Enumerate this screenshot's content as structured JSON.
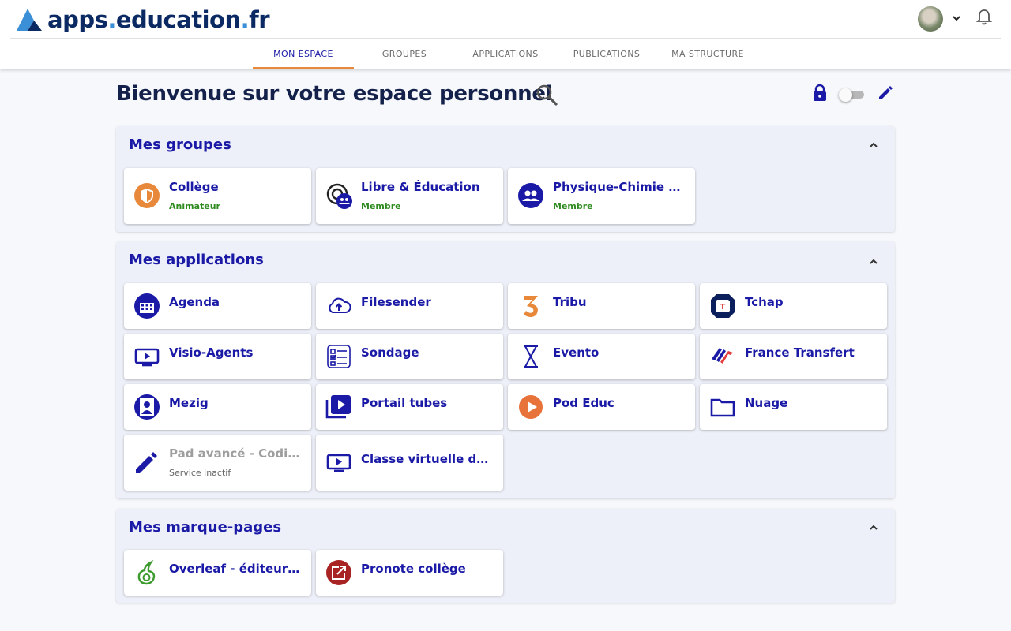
{
  "header": {
    "logo_prefix": "apps",
    "logo_dot1": ".",
    "logo_middle": "education",
    "logo_dot2": ".",
    "logo_suffix": "fr",
    "tabs": [
      {
        "label": "MON ESPACE",
        "active": true
      },
      {
        "label": "GROUPES",
        "active": false
      },
      {
        "label": "APPLICATIONS",
        "active": false
      },
      {
        "label": "PUBLICATIONS",
        "active": false
      },
      {
        "label": "MA STRUCTURE",
        "active": false
      }
    ]
  },
  "page": {
    "title": "Bienvenue sur votre espace personnel"
  },
  "groups": {
    "title": "Mes groupes",
    "items": [
      {
        "name": "Collège",
        "role": "Animateur",
        "icon": "shield-icon"
      },
      {
        "name": "Libre & Éducation",
        "role": "Membre",
        "icon": "group-sync-icon"
      },
      {
        "name": "Physique-Chimie et algorithmique",
        "role": "Membre",
        "icon": "people-icon"
      }
    ]
  },
  "applications": {
    "title": "Mes applications",
    "items": [
      {
        "name": "Agenda",
        "icon": "calendar-icon"
      },
      {
        "name": "Filesender",
        "icon": "cloud-upload-icon"
      },
      {
        "name": "Tribu",
        "icon": "tribu-icon"
      },
      {
        "name": "Tchap",
        "icon": "tchap-icon"
      },
      {
        "name": "Visio-Agents",
        "icon": "video-screen-icon"
      },
      {
        "name": "Sondage",
        "icon": "checklist-icon"
      },
      {
        "name": "Evento",
        "icon": "hourglass-icon"
      },
      {
        "name": "France Transfert",
        "icon": "france-transfert-icon"
      },
      {
        "name": "Mezig",
        "icon": "profile-icon"
      },
      {
        "name": "Portail tubes",
        "icon": "video-library-icon"
      },
      {
        "name": "Pod Educ",
        "icon": "play-circle-icon"
      },
      {
        "name": "Nuage",
        "icon": "folder-icon"
      },
      {
        "name": "Pad avancé - Codimd",
        "status": "Service inactif",
        "icon": "pencil-icon"
      },
      {
        "name": "Classe virtuelle des agents",
        "icon": "video-screen-icon"
      }
    ]
  },
  "bookmarks": {
    "title": "Mes marque-pages",
    "items": [
      {
        "name": "Overleaf - éditeur LaTeX",
        "icon": "overleaf-icon"
      },
      {
        "name": "Pronote collège",
        "icon": "external-link-icon"
      }
    ]
  },
  "colors": {
    "primary": "#1a1aa6",
    "accent": "#e8883a",
    "role": "#2e8b1f",
    "section_bg": "#eef0f9"
  }
}
